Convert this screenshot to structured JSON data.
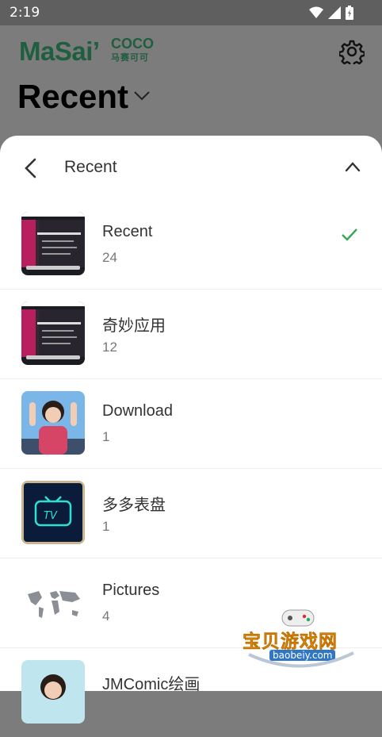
{
  "status_bar": {
    "time": "2:19"
  },
  "app": {
    "brand": "MaSai’",
    "brand_sub": "COCO",
    "brand_cn": "马赛可可",
    "page_title": "Recent"
  },
  "sheet": {
    "title": "Recent",
    "albums": [
      {
        "name": "Recent",
        "count": "24",
        "selected": true
      },
      {
        "name": "奇妙应用",
        "count": "12",
        "selected": false
      },
      {
        "name": "Download",
        "count": "1",
        "selected": false
      },
      {
        "name": "多多表盘",
        "count": "1",
        "selected": false
      },
      {
        "name": "Pictures",
        "count": "4",
        "selected": false
      },
      {
        "name": "JMComic绘画",
        "count": "",
        "selected": false
      }
    ]
  },
  "watermark": {
    "cn": "宝贝游戏网",
    "en": "baobeiy.com"
  },
  "colors": {
    "check": "#3aa657",
    "brand": "#1f5e3f"
  }
}
